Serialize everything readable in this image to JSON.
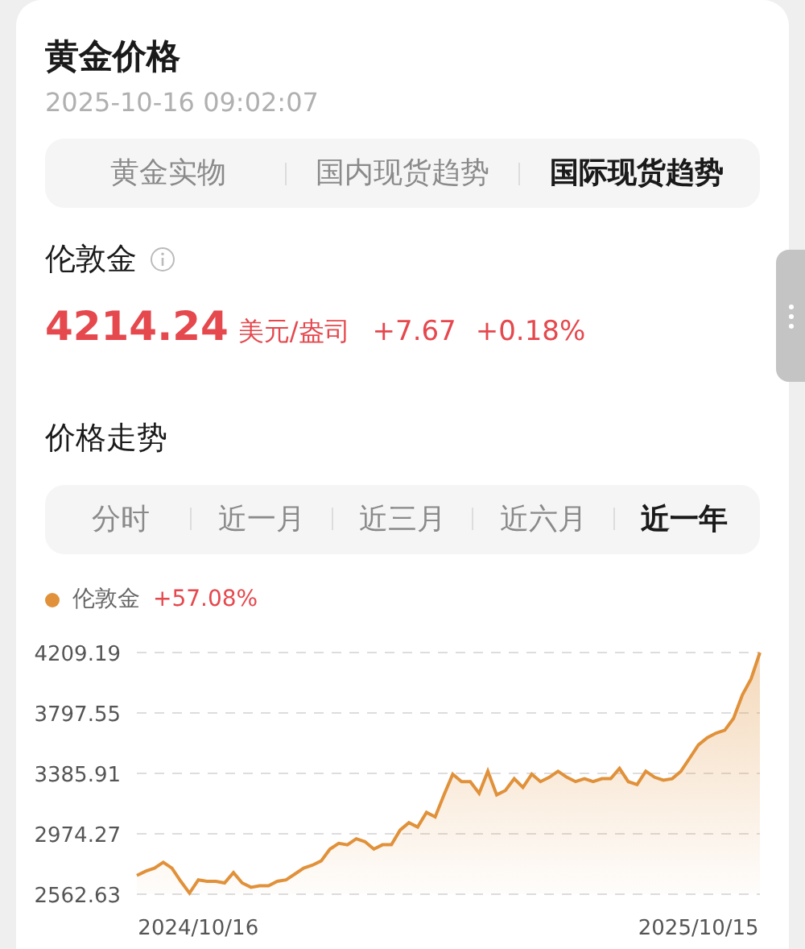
{
  "header": {
    "title": "黄金价格",
    "timestamp": "2025-10-16 09:02:07"
  },
  "market_tabs": [
    {
      "label": "黄金实物",
      "selected": false
    },
    {
      "label": "国内现货趋势",
      "selected": false
    },
    {
      "label": "国际现货趋势",
      "selected": true
    }
  ],
  "quote": {
    "name": "伦敦金",
    "price": "4214.24",
    "unit": "美元/盎司",
    "change": "+7.67",
    "change_percent": "+0.18%"
  },
  "trend": {
    "title": "价格走势",
    "range_tabs": [
      {
        "label": "分时",
        "selected": false
      },
      {
        "label": "近一月",
        "selected": false
      },
      {
        "label": "近三月",
        "selected": false
      },
      {
        "label": "近六月",
        "selected": false
      },
      {
        "label": "近一年",
        "selected": true
      }
    ],
    "legend_change": "+57.08%",
    "chart_data": {
      "type": "area",
      "categories": [
        null,
        null,
        null,
        null,
        null,
        null,
        null,
        "2024/10/16",
        null,
        null,
        null,
        null,
        null,
        null,
        null,
        null,
        null,
        null,
        null,
        null,
        null,
        null,
        null,
        null,
        null,
        null,
        null,
        null,
        null,
        null,
        null,
        null,
        null,
        null,
        null,
        null,
        null,
        null,
        null,
        null,
        null,
        null,
        null,
        null,
        null,
        null,
        null,
        null,
        null,
        null,
        null,
        null,
        null,
        null,
        null,
        null,
        null,
        null,
        null,
        null,
        null,
        null,
        null,
        null,
        "2025/10/15",
        null,
        null,
        null,
        null,
        null,
        null,
        null
      ],
      "grid": true,
      "yticks": [
        2562.63,
        2974.27,
        3385.91,
        3797.55,
        4209.19
      ],
      "ylim": [
        2562.63,
        4209.19
      ],
      "series": [
        {
          "name": "伦敦金",
          "color": "#e0913a",
          "values": [
            2690,
            2720,
            2740,
            2780,
            2740,
            2650,
            2570,
            2660,
            2650,
            2650,
            2640,
            2710,
            2640,
            2610,
            2620,
            2620,
            2650,
            2660,
            2700,
            2740,
            2760,
            2790,
            2870,
            2910,
            2900,
            2940,
            2920,
            2870,
            2900,
            2900,
            3000,
            3050,
            3020,
            3120,
            3090,
            3240,
            3380,
            3330,
            3330,
            3250,
            3400,
            3240,
            3270,
            3350,
            3290,
            3380,
            3330,
            3360,
            3400,
            3360,
            3330,
            3350,
            3330,
            3350,
            3350,
            3420,
            3330,
            3310,
            3400,
            3360,
            3340,
            3350,
            3400,
            3490,
            3580,
            3630,
            3660,
            3680,
            3760,
            3920,
            4030,
            4209
          ]
        }
      ]
    }
  }
}
